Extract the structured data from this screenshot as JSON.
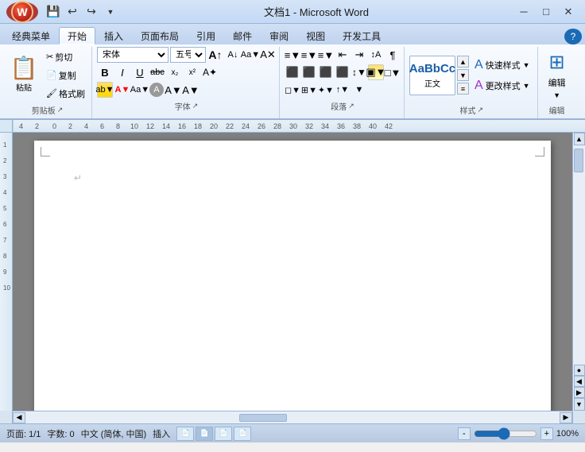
{
  "titlebar": {
    "title": "文档1 - Microsoft Word",
    "minimize": "─",
    "maximize": "□",
    "close": "✕"
  },
  "quickaccess": {
    "save": "💾",
    "undo": "↩",
    "redo": "↪",
    "dropdown": "▼"
  },
  "tabs": [
    {
      "id": "classic",
      "label": "经典菜单",
      "active": false
    },
    {
      "id": "home",
      "label": "开始",
      "active": true
    },
    {
      "id": "insert",
      "label": "插入",
      "active": false
    },
    {
      "id": "layout",
      "label": "页面布局",
      "active": false
    },
    {
      "id": "references",
      "label": "引用",
      "active": false
    },
    {
      "id": "mail",
      "label": "邮件",
      "active": false
    },
    {
      "id": "review",
      "label": "审阅",
      "active": false
    },
    {
      "id": "view",
      "label": "视图",
      "active": false
    },
    {
      "id": "developer",
      "label": "开发工具",
      "active": false
    }
  ],
  "clipboard": {
    "paste_label": "粘贴",
    "cut_label": "剪切",
    "copy_label": "复制",
    "format_label": "格式刷",
    "group_label": "剪贴板"
  },
  "font": {
    "name": "宋体",
    "size": "五号",
    "bold": "B",
    "italic": "I",
    "underline": "U",
    "strikethrough": "abc",
    "subscript": "x₂",
    "superscript": "x²",
    "group_label": "字体",
    "aa_btn": "Aa",
    "font_color": "A",
    "highlight": "ab"
  },
  "paragraph": {
    "group_label": "段落",
    "bullets": "≡",
    "numbering": "≡",
    "outline": "≡",
    "decrease_indent": "⇤",
    "increase_indent": "⇥",
    "sort": "↕",
    "show_hide": "¶",
    "align_left": "≡",
    "align_center": "≡",
    "align_right": "≡",
    "justify": "≡",
    "line_spacing": "↕",
    "shade": "▣",
    "border": "□"
  },
  "styles": {
    "quick_label": "快速样式",
    "change_label": "更改样式",
    "edit_label": "编辑",
    "normal_label": "正文",
    "group_label": "样式"
  },
  "editing": {
    "edit_label": "编辑",
    "group_label": "编辑"
  },
  "statusbar": {
    "page": "页面: 1/1",
    "words": "字数: 0",
    "lang": "中文 (简体, 中国)",
    "mode": "插入",
    "zoom": "100%"
  }
}
